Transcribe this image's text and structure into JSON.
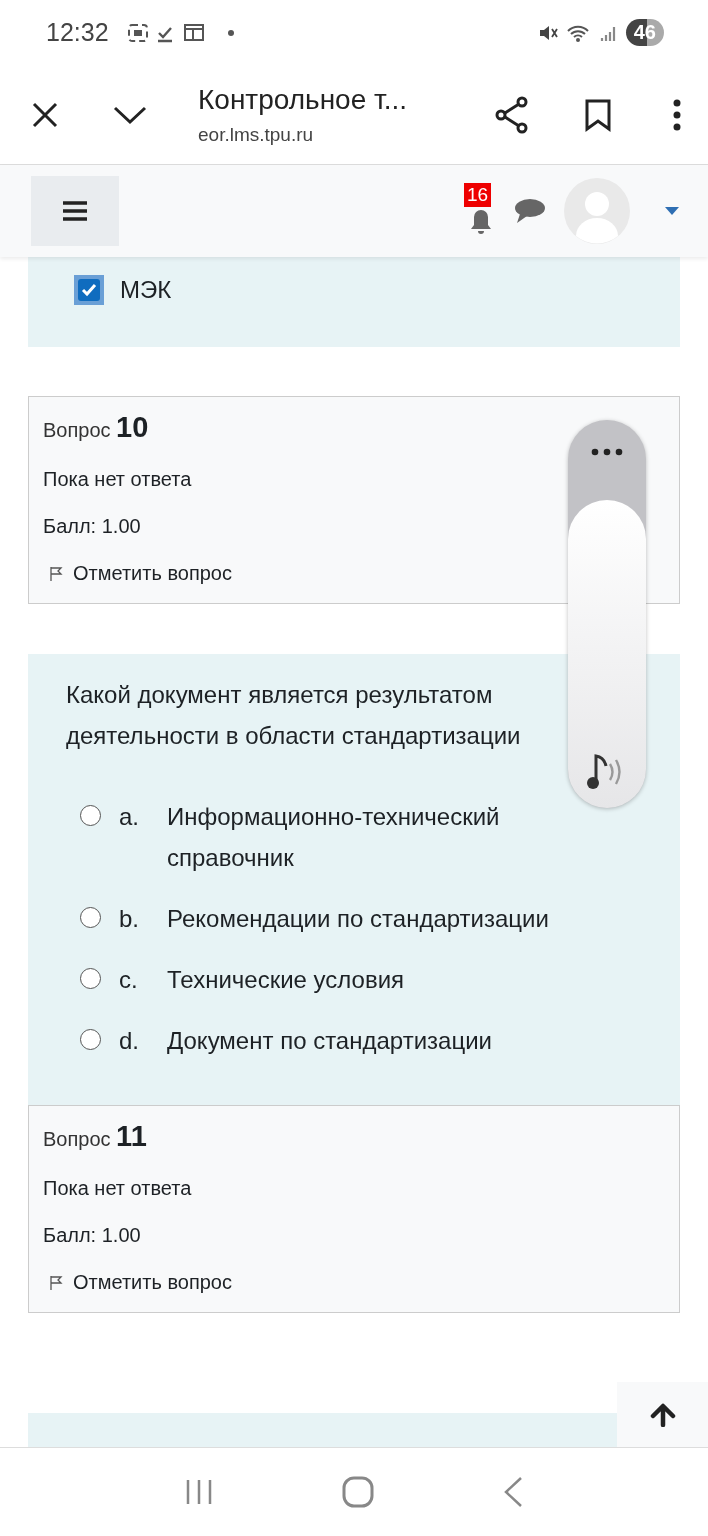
{
  "status_bar": {
    "time": "12:32",
    "battery": "46"
  },
  "browser_bar": {
    "title": "Контрольное т...",
    "url": "eor.lms.tpu.ru"
  },
  "navbar": {
    "notification_count": "16"
  },
  "prev_answer": {
    "label": "МЭК",
    "checked": true
  },
  "questions": [
    {
      "label": "Вопрос",
      "number": "10",
      "status": "Пока нет ответа",
      "mark": "Балл: 1.00",
      "flag": "Отметить вопрос",
      "text": "Какой документ является результатом деятельности в области стандартизации",
      "options": [
        {
          "letter": "a.",
          "text": "Информационно-технический справочник",
          "selected": false
        },
        {
          "letter": "b.",
          "text": "Рекомендации по стандартизации",
          "selected": false
        },
        {
          "letter": "c.",
          "text": "Технические условия",
          "selected": false
        },
        {
          "letter": "d.",
          "text": "Документ по стандартизации",
          "selected": false
        }
      ]
    },
    {
      "label": "Вопрос",
      "number": "11",
      "status": "Пока нет ответа",
      "mark": "Балл: 1.00",
      "flag": "Отметить вопрос"
    }
  ]
}
